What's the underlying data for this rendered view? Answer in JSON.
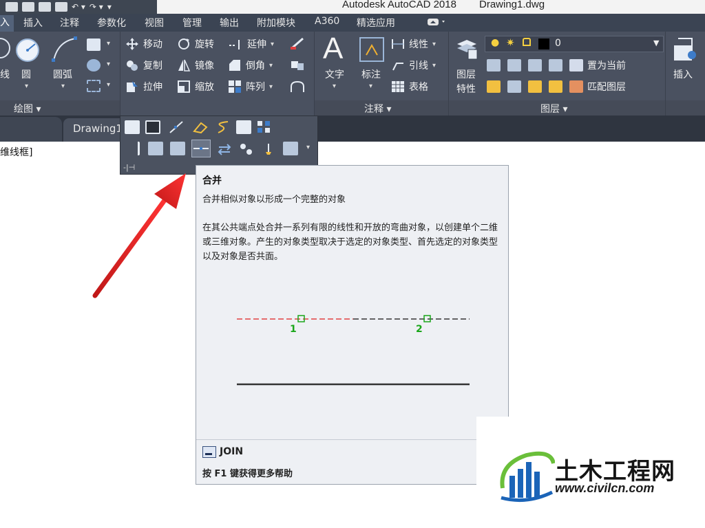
{
  "window": {
    "app_title": "Autodesk AutoCAD 2018",
    "document_title": "Drawing1.dwg"
  },
  "ribbon": {
    "tabs": [
      {
        "label": "入"
      },
      {
        "label": "插入"
      },
      {
        "label": "注释"
      },
      {
        "label": "参数化"
      },
      {
        "label": "视图"
      },
      {
        "label": "管理"
      },
      {
        "label": "输出"
      },
      {
        "label": "附加模块"
      },
      {
        "label": "A360"
      },
      {
        "label": "精选应用"
      }
    ],
    "draw": {
      "line_label": "线",
      "circle_label": "圆",
      "arc_label": "圆弧",
      "panel_label": "绘图 ▾"
    },
    "modify": {
      "move": "移动",
      "rotate": "旋转",
      "extend": "延伸",
      "copy": "复制",
      "mirror": "镜像",
      "chamfer": "倒角",
      "stretch": "拉伸",
      "scale": "缩放",
      "array": "阵列"
    },
    "annotation": {
      "text": "文字",
      "dimension": "标注",
      "linear": "线性",
      "leader": "引线",
      "table": "表格",
      "panel_label": "注释 ▾"
    },
    "layers": {
      "properties_line1": "图层",
      "properties_line2": "特性",
      "current_layer": "0",
      "set_current": "置为当前",
      "match_layer": "匹配图层",
      "panel_label": "图层 ▾"
    },
    "block": {
      "insert": "插入"
    }
  },
  "document_tab": {
    "label": "Drawing1"
  },
  "viewport": {
    "label": "维线框]"
  },
  "tooltip": {
    "title": "合并",
    "summary": "合并相似对象以形成一个完整的对象",
    "description": "在其公共端点处合并一系列有限的线性和开放的弯曲对象，以创建单个二维或三维对象。产生的对象类型取决于选定的对象类型、首先选定的对象类型以及对象是否共面。",
    "diagram": {
      "point1": "1",
      "point2": "2"
    },
    "command": "JOIN",
    "help": "按 F1 键获得更多帮助"
  },
  "watermark": {
    "name": "土木工程网",
    "url": "www.civilcn.com"
  },
  "colors": {
    "ribbon_bg": "#4a5160",
    "tab_bar": "#3b4453",
    "tooltip_bg": "#eef0f4",
    "arrow": "#e02020",
    "join_red": "#e04040",
    "point_green": "#1aa61a"
  }
}
